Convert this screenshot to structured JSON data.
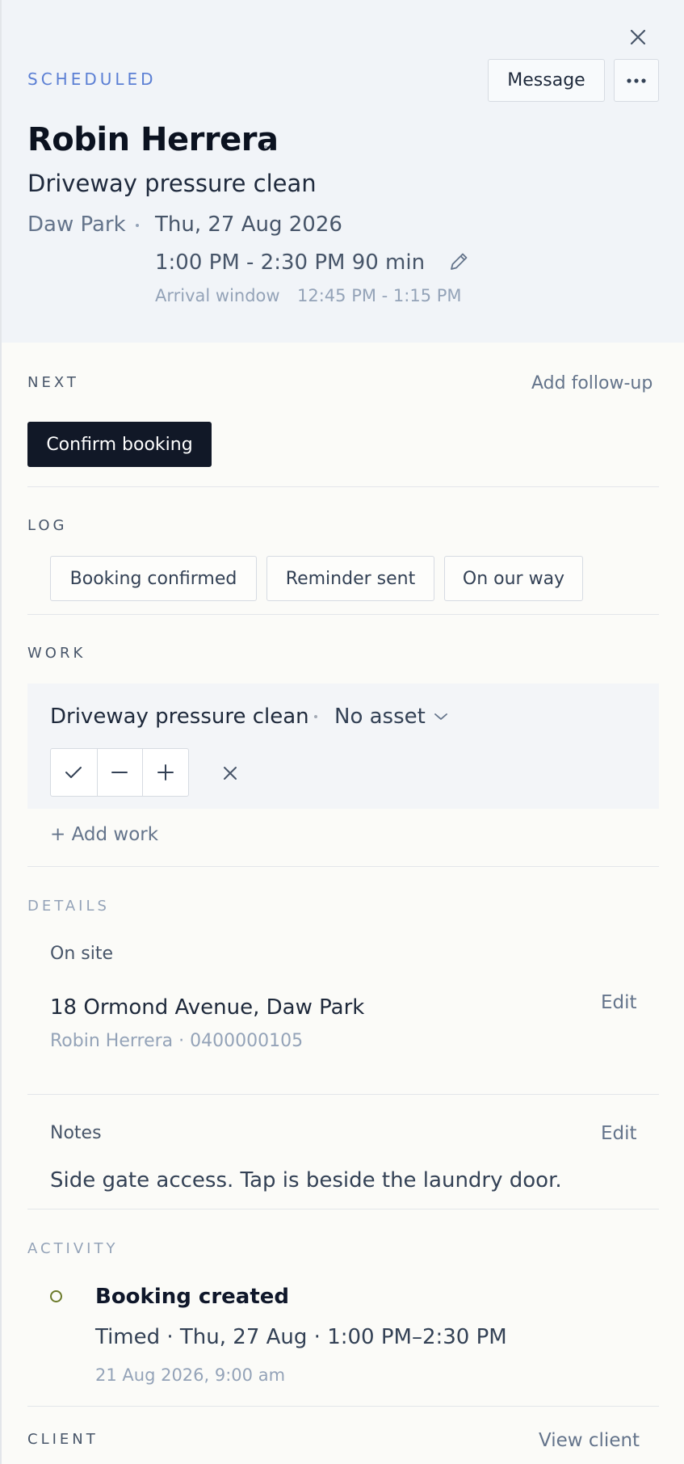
{
  "header": {
    "status": "SCHEDULED",
    "message_label": "Message",
    "client_name": "Robin Herrera",
    "service": "Driveway pressure clean",
    "area": "Daw Park",
    "date": "Thu, 27 Aug 2026",
    "time": "1:00 PM - 2:30 PM 90 min",
    "arrival_label": "Arrival window",
    "arrival_value": "12:45 PM - 1:15 PM"
  },
  "next": {
    "heading": "NEXT",
    "add_follow_up": "Add follow-up",
    "confirm_label": "Confirm booking"
  },
  "log": {
    "heading": "LOG",
    "chips": [
      "Booking confirmed",
      "Reminder sent",
      "On our way"
    ]
  },
  "work": {
    "heading": "WORK",
    "item_title": "Driveway pressure clean",
    "asset": "No asset",
    "add_work": "+ Add work"
  },
  "details": {
    "heading": "DETAILS",
    "on_site_label": "On site",
    "address": "18 Ormond Avenue, Daw Park",
    "contact": "Robin Herrera · 0400000105",
    "edit_label": "Edit",
    "notes_label": "Notes",
    "notes_edit_label": "Edit",
    "notes_text": "Side gate access. Tap is beside the laundry door."
  },
  "activity": {
    "heading": "ACTIVITY",
    "title": "Booking created",
    "description": "Timed · Thu, 27 Aug · 1:00 PM–2:30 PM",
    "timestamp": "21 Aug 2026, 9:00 am"
  },
  "client": {
    "heading": "CLIENT",
    "view_client": "View client"
  },
  "icons": {
    "close": "close-icon",
    "more": "more-horizontal-icon",
    "edit": "pencil-icon",
    "chevron": "chevron-down-icon",
    "check": "check-icon",
    "minus": "minus-icon",
    "plus": "plus-icon",
    "remove": "close-icon"
  },
  "colors": {
    "accent": "#5b7fd4",
    "primary_button": "#111827",
    "activity_ring": "#6b7a2a"
  }
}
